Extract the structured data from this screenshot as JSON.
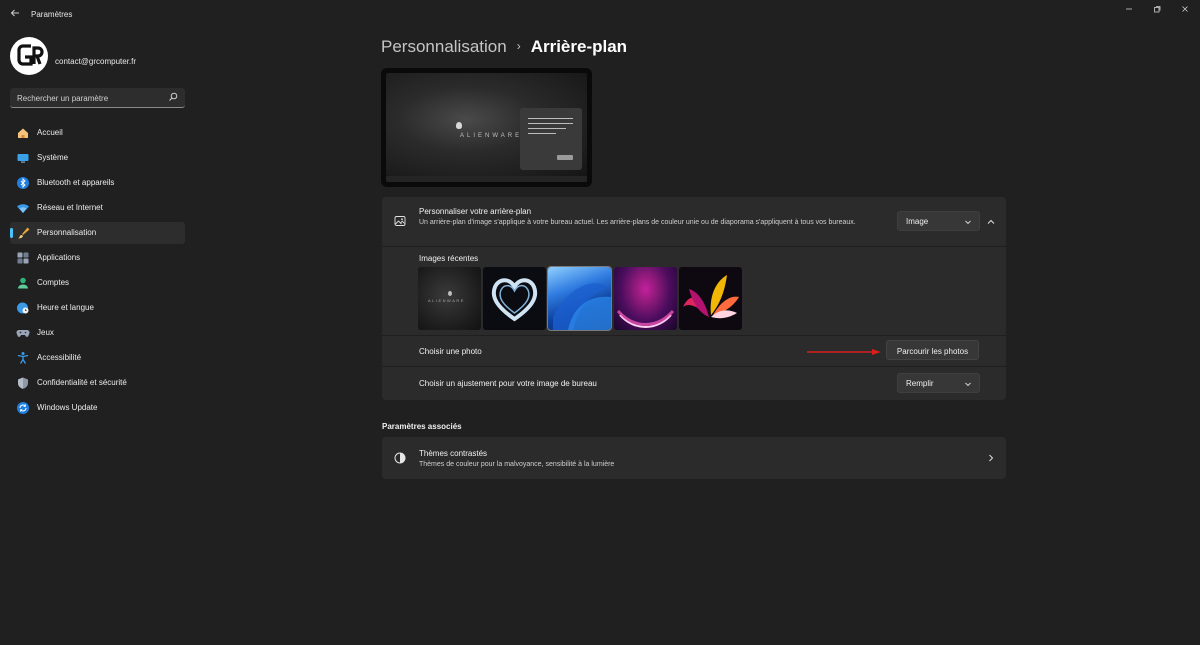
{
  "window": {
    "title": "Paramètres"
  },
  "user": {
    "email": "contact@grcomputer.fr"
  },
  "search": {
    "placeholder": "Rechercher un paramètre"
  },
  "sidebar": {
    "items": [
      {
        "label": "Accueil",
        "icon": "home-icon"
      },
      {
        "label": "Système",
        "icon": "monitor-icon"
      },
      {
        "label": "Bluetooth et appareils",
        "icon": "bluetooth-icon"
      },
      {
        "label": "Réseau et Internet",
        "icon": "wifi-icon"
      },
      {
        "label": "Personnalisation",
        "icon": "brush-icon",
        "active": true
      },
      {
        "label": "Applications",
        "icon": "apps-icon"
      },
      {
        "label": "Comptes",
        "icon": "person-icon"
      },
      {
        "label": "Heure et langue",
        "icon": "globe-clock-icon"
      },
      {
        "label": "Jeux",
        "icon": "gamepad-icon"
      },
      {
        "label": "Accessibilité",
        "icon": "accessibility-icon"
      },
      {
        "label": "Confidentialité et sécurité",
        "icon": "shield-icon"
      },
      {
        "label": "Windows Update",
        "icon": "update-icon"
      }
    ]
  },
  "breadcrumb": {
    "parent": "Personnalisation",
    "separator": "›",
    "current": "Arrière-plan"
  },
  "preview": {
    "brand": "ALIENWARE"
  },
  "background": {
    "title": "Personnaliser votre arrière-plan",
    "description": "Un arrière-plan d'image s'applique à votre bureau actuel. Les arrière-plans de couleur unie ou de diaporama s'appliquent à tous vos bureaux.",
    "type_value": "Image",
    "recent_label": "Images récentes",
    "recent_brand": "ALIENWARE",
    "choose_photo_label": "Choisir une photo",
    "browse_label": "Parcourir les photos",
    "fit_label": "Choisir un ajustement pour votre image de bureau",
    "fit_value": "Remplir"
  },
  "related": {
    "section_title": "Paramètres associés",
    "themes_title": "Thèmes contrastés",
    "themes_desc": "Thèmes de couleur pour la malvoyance, sensibilité à la lumière"
  },
  "colors": {
    "accent": "#4cc2ff",
    "background": "#202020",
    "card": "#2b2b2b",
    "arrow": "#d81e1e"
  }
}
